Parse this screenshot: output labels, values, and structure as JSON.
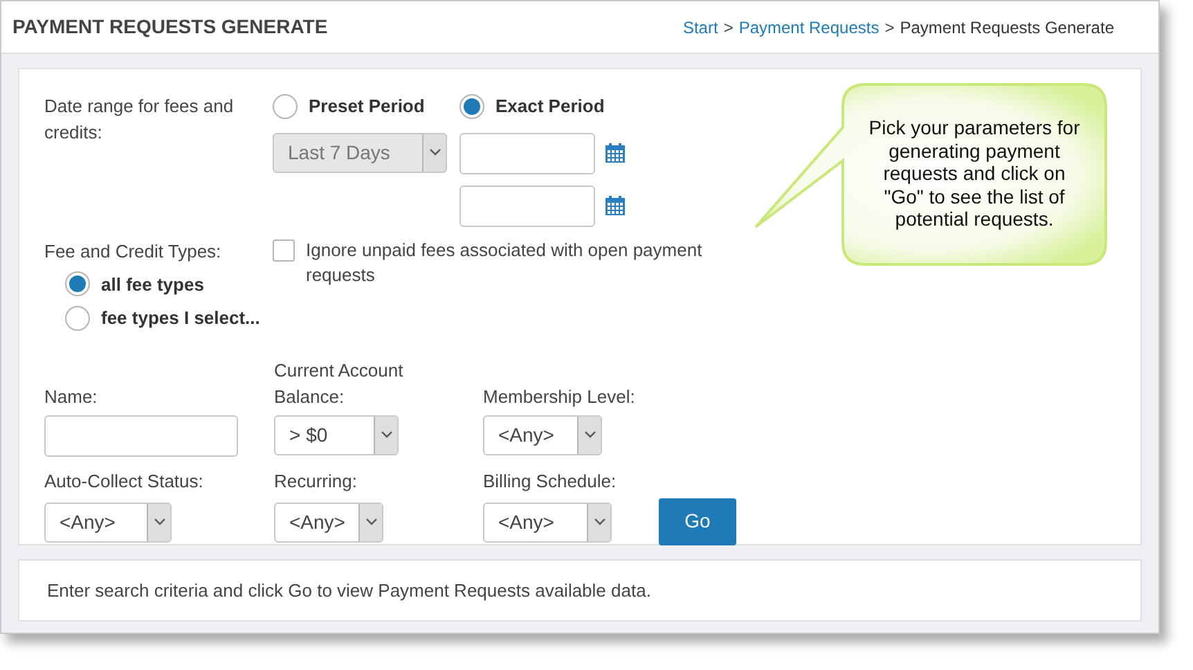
{
  "header": {
    "title": "PAYMENT REQUESTS GENERATE",
    "breadcrumb": [
      {
        "label": "Start",
        "link": true
      },
      {
        "separator": ">",
        "label": "Payment Requests",
        "link": true
      },
      {
        "separator": ">",
        "label": "Payment Requests Generate",
        "link": false
      }
    ]
  },
  "date_range": {
    "label": "Date range for fees and credits:",
    "options": [
      {
        "label": "Preset Period",
        "selected": false
      },
      {
        "label": "Exact Period",
        "selected": true
      }
    ],
    "preset_select": {
      "value": "Last 7 Days",
      "disabled": true
    }
  },
  "fee_types": {
    "label": "Fee and Credit Types:",
    "options": [
      {
        "label": "all fee types",
        "selected": true
      },
      {
        "label": "fee types I select...",
        "selected": false
      }
    ]
  },
  "ignore_unpaid": {
    "label": "Ignore unpaid fees associated with open payment requests",
    "checked": false
  },
  "filters": [
    {
      "label": "Name:",
      "kind": "text"
    },
    {
      "label": "Current Account Balance:",
      "kind": "select",
      "value": "> $0"
    },
    {
      "label": "Membership Level:",
      "kind": "select",
      "value": "<Any>"
    },
    {
      "label": "Auto-Collect Status:",
      "kind": "select",
      "value": "<Any>"
    },
    {
      "label": "Recurring:",
      "kind": "select",
      "value": "<Any>"
    },
    {
      "label": "Billing Schedule:",
      "kind": "select",
      "value": "<Any>"
    }
  ],
  "go_button": "Go",
  "status_message": "Enter search criteria and click Go to view Payment Requests available data.",
  "callout": "Pick your parameters for generating payment requests and click on \"Go\" to see the list of potential requests."
}
